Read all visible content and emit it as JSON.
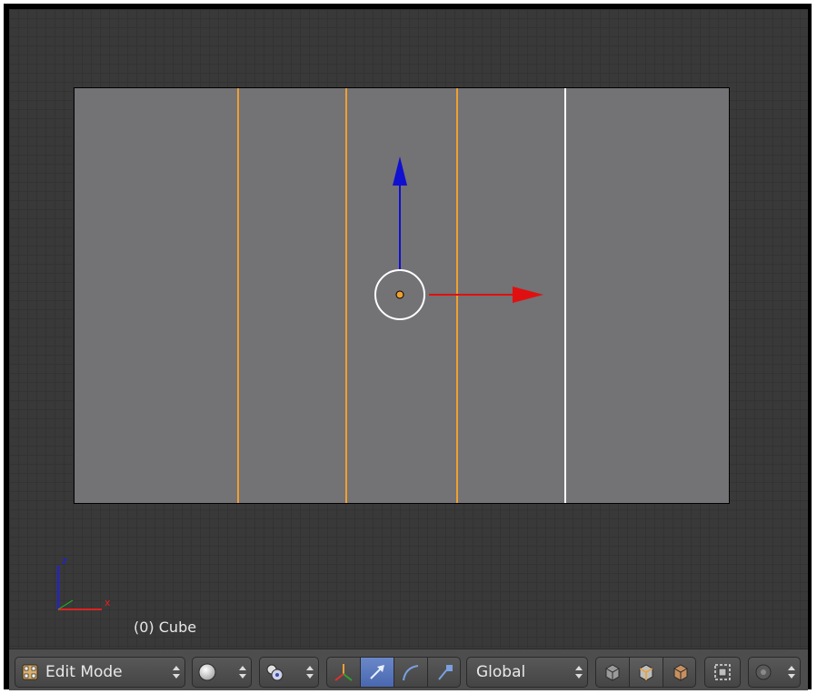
{
  "viewport": {
    "object_label": "(0) Cube",
    "axis_labels": {
      "z": "z",
      "x": "x"
    },
    "colors": {
      "background": "#393939",
      "face": "#737275",
      "selected_edge": "#f0a030",
      "active_edge": "#ffffff",
      "manipulator_z": "#1010d0",
      "manipulator_x": "#e01010"
    }
  },
  "header": {
    "mode_selector": {
      "label": "Edit Mode",
      "icon": "edit-mode-cube-icon"
    },
    "viewport_shading": {
      "icon": "solid-sphere-icon"
    },
    "pivot_point": {
      "icon": "pivot-point-icon"
    },
    "manipulator": {
      "toggle_icon": "manipulator-axes-icon",
      "translate_icon": "translate-arrow-icon",
      "rotate_icon": "rotate-arc-icon",
      "scale_icon": "scale-icon"
    },
    "transform_orientation": {
      "label": "Global"
    },
    "select_mode": {
      "vertex_icon": "vertex-select-icon",
      "edge_icon": "edge-select-icon",
      "face_icon": "face-select-icon"
    },
    "occlude_geometry_icon": "limit-selection-visible-icon",
    "proportional_editing_icon": "proportional-editing-icon"
  }
}
